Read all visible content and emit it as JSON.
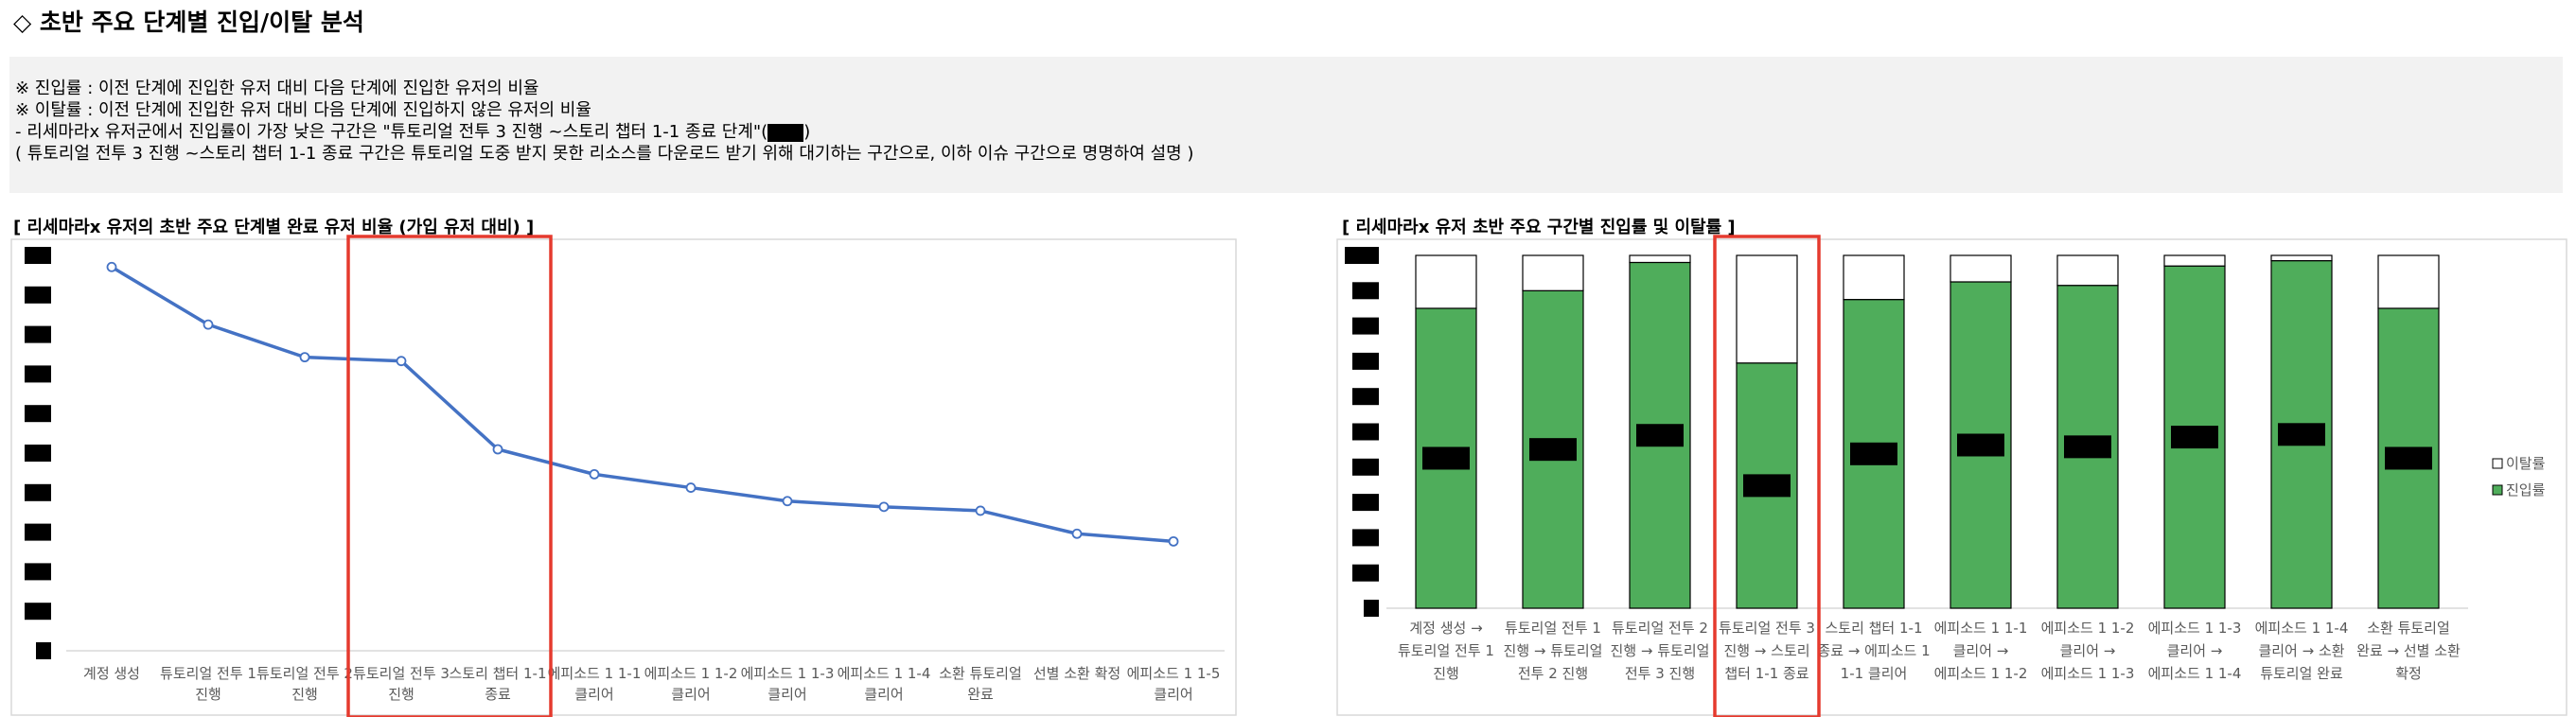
{
  "page": {
    "title": "◇ 초반 주요 단계별 진입/이탈 분석"
  },
  "notes": [
    "※ 진입률 : 이전 단계에 진입한 유저 대비 다음 단계에 진입한 유저의 비율",
    "※ 이탈률 : 이전 단계에 진입한 유저 대비 다음 단계에 진입하지 않은 유저의 비율",
    "- 리세마라x 유저군에서 진입률이 가장 낮은 구간은 \"튜토리얼 전투 3 진행 ~스토리 챕터 1-1 종료 단계\"(",
    "( 튜토리얼 전투 3 진행 ~스토리 챕터 1-1 종료 구간은 튜토리얼 도중 받지 못한 리소스를 다운로드 받기 위해 대기하는 구간으로, 이하 이슈 구간으로 명명하여 설명 )"
  ],
  "note3_suffix": ")",
  "colors": {
    "line": "#4472c4",
    "enter": "#4fad5b",
    "exit": "#ffffff",
    "highlight": "#e53a2e",
    "notes_bg": "#f2f2f2",
    "redaction": "#000000"
  },
  "chart_data": [
    {
      "type": "line",
      "title": "[ 리세마라x 유저의 초반 주요 단계별 완료 유저 비율 (가입 유저 대비) ]",
      "categories": [
        [
          "계정 생성"
        ],
        [
          "튜토리얼 전투 1",
          "진행"
        ],
        [
          "튜토리얼 전투 2",
          "진행"
        ],
        [
          "튜토리얼 전투 3",
          "진행"
        ],
        [
          "스토리 챕터 1-1",
          "종료"
        ],
        [
          "에피소드 1 1-1",
          "클리어"
        ],
        [
          "에피소드 1 1-2",
          "클리어"
        ],
        [
          "에피소드 1 1-3",
          "클리어"
        ],
        [
          "에피소드 1 1-4",
          "클리어"
        ],
        [
          "소환 튜토리얼",
          "완료"
        ],
        [
          "선별 소환 확정"
        ],
        [
          "에피소드 1 1-5",
          "클리어"
        ]
      ],
      "values": [
        100,
        85,
        76.5,
        75.5,
        52.5,
        46,
        42.5,
        39,
        37.5,
        36.5,
        30.5,
        28.5
      ],
      "ylim": [
        0,
        105
      ],
      "y_tick_labels_redacted": 11,
      "highlight_categories": [
        3,
        4
      ],
      "grid": false
    },
    {
      "type": "bar",
      "stacked": true,
      "title": "[ 리세마라x 유저 초반 주요 구간별 진입률 및 이탈률 ]",
      "categories": [
        [
          "계정 생성 →",
          "튜토리얼 전투 1",
          "진행"
        ],
        [
          "튜토리얼 전투 1",
          "진행 → 튜토리얼",
          "전투 2 진행"
        ],
        [
          "튜토리얼 전투 2",
          "진행 → 튜토리얼",
          "전투 3 진행"
        ],
        [
          "튜토리얼 전투 3",
          "진행 → 스토리",
          "챕터 1-1 종료"
        ],
        [
          "스토리 챕터 1-1",
          "종료 → 에피소드 1",
          "1-1 클리어"
        ],
        [
          "에피소드 1 1-1",
          "클리어 →",
          "에피소드 1 1-2"
        ],
        [
          "에피소드 1 1-2",
          "클리어 →",
          "에피소드 1 1-3"
        ],
        [
          "에피소드 1 1-3",
          "클리어 →",
          "에피소드 1 1-4"
        ],
        [
          "에피소드 1 1-4",
          "클리어 → 소환",
          "튜토리얼 완료"
        ],
        [
          "소환 튜토리얼",
          "완료 → 선별 소환",
          "확정"
        ]
      ],
      "series": [
        {
          "name": "진입률",
          "values": [
            85,
            90,
            98,
            69.5,
            87.5,
            92.5,
            91.5,
            97,
            98.5,
            85
          ]
        },
        {
          "name": "이탈률",
          "values": [
            15,
            10,
            2,
            30.5,
            12.5,
            7.5,
            8.5,
            3,
            1.5,
            15
          ]
        }
      ],
      "ylim": [
        0,
        100
      ],
      "y_tick_labels_redacted": 11,
      "data_labels_redacted": true,
      "highlight_categories": [
        3
      ],
      "legend_position": "right",
      "grid": false
    }
  ]
}
